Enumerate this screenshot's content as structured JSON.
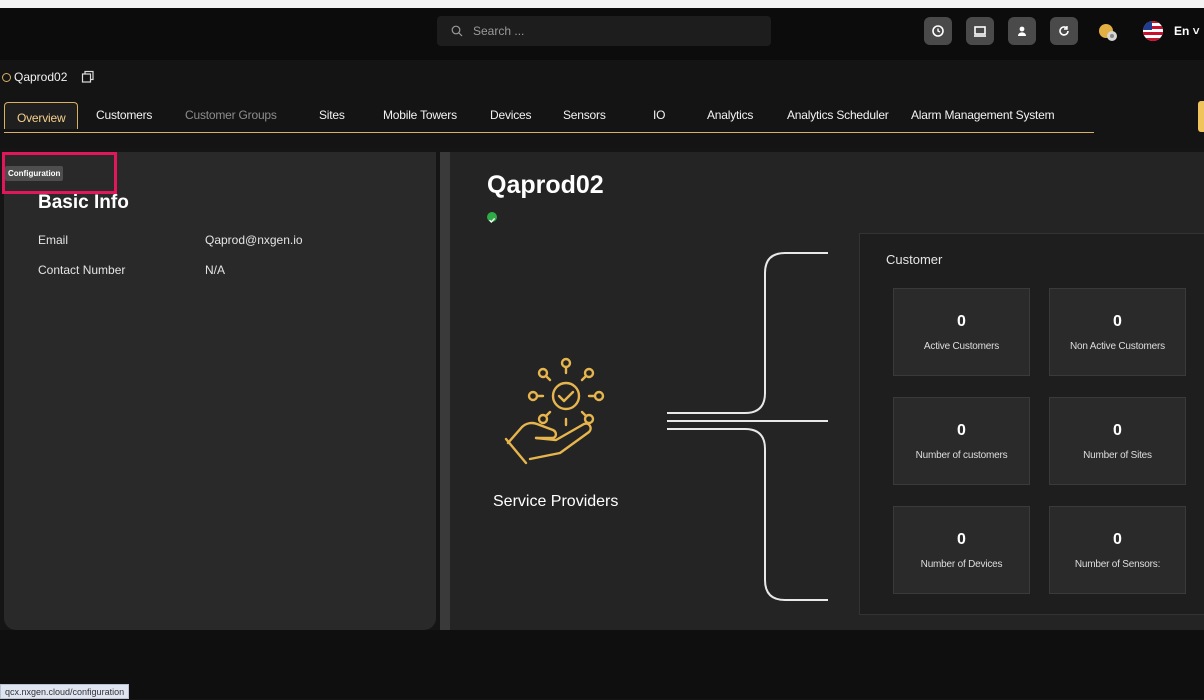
{
  "search": {
    "placeholder": "Search ..."
  },
  "lang": "En",
  "tenant": {
    "name": "Qaprod02"
  },
  "tabs": [
    {
      "label": "Overview",
      "active": true
    },
    {
      "label": "Customers"
    },
    {
      "label": "Customer Groups",
      "dim": true
    },
    {
      "label": "Sites"
    },
    {
      "label": "Mobile Towers"
    },
    {
      "label": "Devices"
    },
    {
      "label": "Sensors"
    },
    {
      "label": "IO"
    },
    {
      "label": "Analytics"
    },
    {
      "label": "Analytics Scheduler"
    },
    {
      "label": "Alarm Management System"
    }
  ],
  "tooltip": "Configuration",
  "basic_info": {
    "title": "Basic Info",
    "email_label": "Email",
    "email_value": "Qaprod@nxgen.io",
    "contact_label": "Contact Number",
    "contact_value": "N/A"
  },
  "main": {
    "title": "Qaprod02",
    "service_label": "Service Providers"
  },
  "customer": {
    "title": "Customer",
    "stats": [
      {
        "value": "0",
        "label": "Active Customers"
      },
      {
        "value": "0",
        "label": "Non Active Customers"
      },
      {
        "value": "0",
        "label": "Number of customers"
      },
      {
        "value": "0",
        "label": "Number of Sites"
      },
      {
        "value": "0",
        "label": "Number of Devices"
      },
      {
        "value": "0",
        "label": "Number of Sensors:"
      }
    ]
  },
  "status_url": "qcx.nxgen.cloud/configuration",
  "colors": {
    "accent": "#d8b162",
    "highlight": "#e2165b",
    "success": "#2faa46"
  }
}
